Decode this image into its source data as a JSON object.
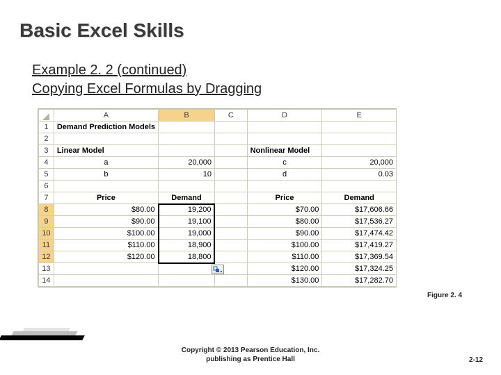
{
  "slide": {
    "title": "Basic Excel Skills",
    "subtitle_line1": "Example 2. 2 (continued)",
    "subtitle_line2": "Copying Excel Formulas by Dragging",
    "figure_caption": "Figure 2. 4",
    "copyright_line1": "Copyright © 2013 Pearson Education, Inc.",
    "copyright_line2": "publishing as Prentice Hall",
    "page_num": "2-12"
  },
  "columns": [
    "A",
    "B",
    "C",
    "D",
    "E"
  ],
  "rows": [
    "1",
    "2",
    "3",
    "4",
    "5",
    "6",
    "7",
    "8",
    "9",
    "10",
    "11",
    "12",
    "13",
    "14"
  ],
  "sheet": {
    "a1": "Demand Prediction Models",
    "a3": "Linear Model",
    "d3": "Nonlinear Model",
    "a4": "a",
    "b4": "20,000",
    "d4": "c",
    "e4": "20,000",
    "a5": "b",
    "b5": "10",
    "d5": "d",
    "e5": "0.03",
    "a7": "Price",
    "b7": "Demand",
    "d7": "Price",
    "e7": "Demand",
    "a8": "$80.00",
    "b8": "19,200",
    "d8": "$70.00",
    "e8": "$17,606.66",
    "a9": "$90.00",
    "b9": "19,100",
    "d9": "$80.00",
    "e9": "$17,536.27",
    "a10": "$100.00",
    "b10": "19,000",
    "d10": "$90.00",
    "e10": "$17,474.42",
    "a11": "$110.00",
    "b11": "18,900",
    "d11": "$100.00",
    "e11": "$17,419.27",
    "a12": "$120.00",
    "b12": "18,800",
    "d12": "$110.00",
    "e12": "$17,369.54",
    "d13": "$120.00",
    "e13": "$17,324.25",
    "d14": "$130.00",
    "e14": "$17,282.70"
  },
  "icons": {
    "autofill": "autofill-options-icon",
    "select_all": "select-all-triangle-icon"
  }
}
